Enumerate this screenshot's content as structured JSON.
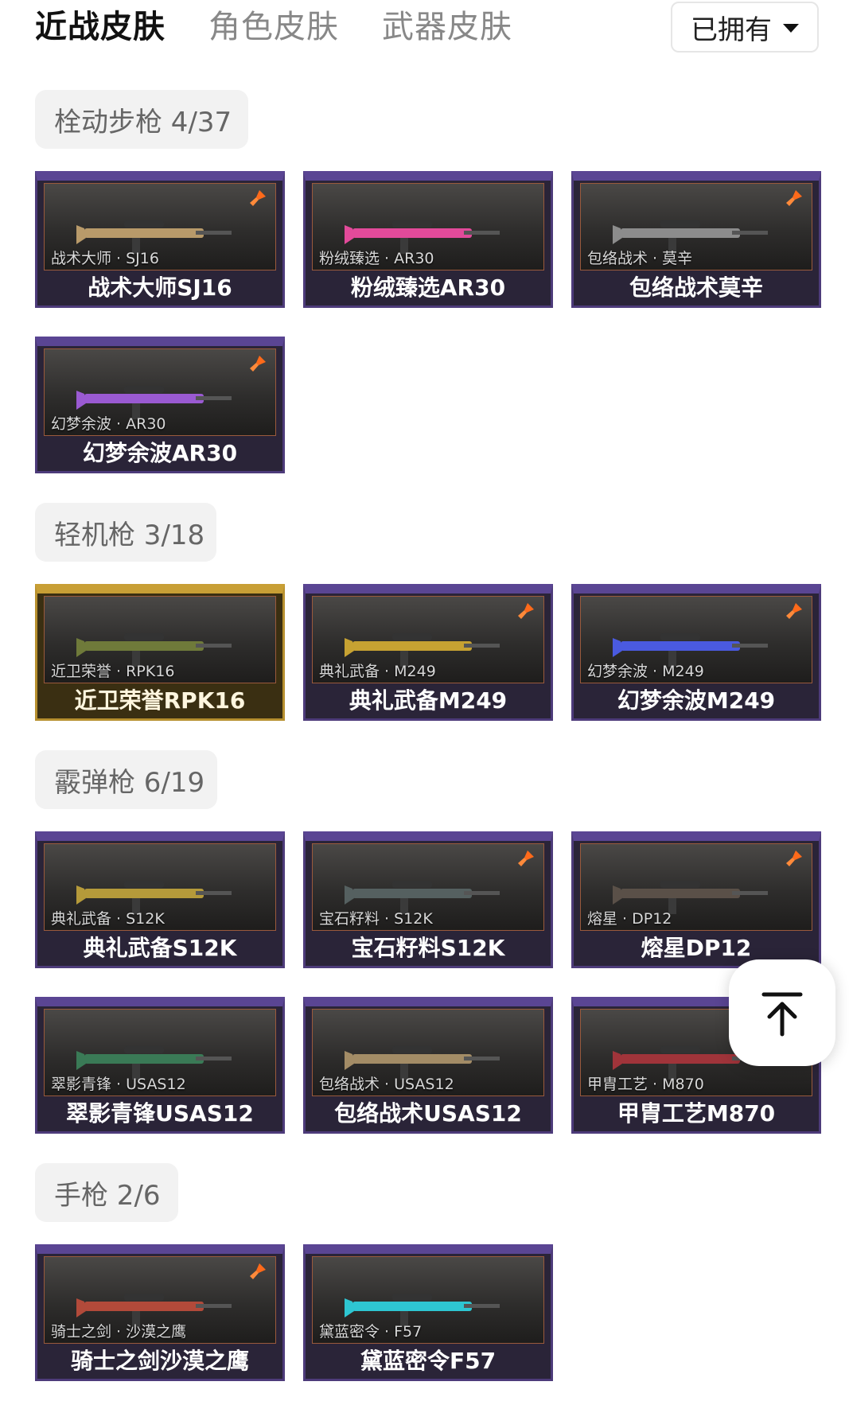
{
  "tabs": [
    {
      "label": "近战皮肤",
      "active": true
    },
    {
      "label": "角色皮肤",
      "active": false
    },
    {
      "label": "武器皮肤",
      "active": false
    }
  ],
  "filter": {
    "label": "已拥有",
    "icon": "caret-down-icon"
  },
  "sections": [
    {
      "title": "栓动步枪 4/37",
      "items": [
        {
          "sub": "战术大师 · SJ16",
          "name": "战术大师SJ16",
          "badge": true,
          "rarity": "purple",
          "gun": "#b89a6a"
        },
        {
          "sub": "粉绒臻选 · AR30",
          "name": "粉绒臻选AR30",
          "badge": false,
          "rarity": "purple",
          "gun": "#e24a9a"
        },
        {
          "sub": "包络战术 · 莫辛",
          "name": "包络战术莫辛",
          "badge": true,
          "rarity": "purple",
          "gun": "#8c8c8c"
        },
        {
          "sub": "幻梦余波 · AR30",
          "name": "幻梦余波AR30",
          "badge": true,
          "rarity": "purple",
          "gun": "#9a5ad2"
        }
      ]
    },
    {
      "title": "轻机枪 3/18",
      "items": [
        {
          "sub": "近卫荣誉 · RPK16",
          "name": "近卫荣誉RPK16",
          "badge": false,
          "rarity": "gold",
          "gun": "#6f7a3a"
        },
        {
          "sub": "典礼武备 · M249",
          "name": "典礼武备M249",
          "badge": true,
          "rarity": "purple",
          "gun": "#c7a232"
        },
        {
          "sub": "幻梦余波 · M249",
          "name": "幻梦余波M249",
          "badge": true,
          "rarity": "purple",
          "gun": "#4a5ae0"
        }
      ]
    },
    {
      "title": "霰弹枪 6/19",
      "items": [
        {
          "sub": "典礼武备 · S12K",
          "name": "典礼武备S12K",
          "badge": false,
          "rarity": "purple",
          "gun": "#b59a3a"
        },
        {
          "sub": "宝石籽料 · S12K",
          "name": "宝石籽料S12K",
          "badge": true,
          "rarity": "purple",
          "gun": "#556060"
        },
        {
          "sub": "熔星 · DP12",
          "name": "熔星DP12",
          "badge": true,
          "rarity": "purple",
          "gun": "#5a5048"
        },
        {
          "sub": "翠影青锋 · USAS12",
          "name": "翠影青锋USAS12",
          "badge": false,
          "rarity": "purple",
          "gun": "#3a7a56"
        },
        {
          "sub": "包络战术 · USAS12",
          "name": "包络战术USAS12",
          "badge": false,
          "rarity": "purple",
          "gun": "#a38c66"
        },
        {
          "sub": "甲胄工艺 · M870",
          "name": "甲胄工艺M870",
          "badge": false,
          "rarity": "purple",
          "gun": "#a0343a"
        }
      ]
    },
    {
      "title": "手枪 2/6",
      "items": [
        {
          "sub": "骑士之剑 · 沙漠之鹰",
          "name": "骑士之剑沙漠之鹰",
          "badge": true,
          "rarity": "purple",
          "gun": "#b24a3a"
        },
        {
          "sub": "黛蓝密令 · F57",
          "name": "黛蓝密令F57",
          "badge": false,
          "rarity": "purple",
          "gun": "#2ec6d2"
        }
      ]
    }
  ],
  "colors": {
    "active_tab": "#111111",
    "inactive_tab": "#888888",
    "card_purple": "#5a4593",
    "card_gold": "#c89f35",
    "badge": "#ff6a1a"
  },
  "scroll_top_button": {
    "icon": "arrow-up-to-top-icon"
  }
}
